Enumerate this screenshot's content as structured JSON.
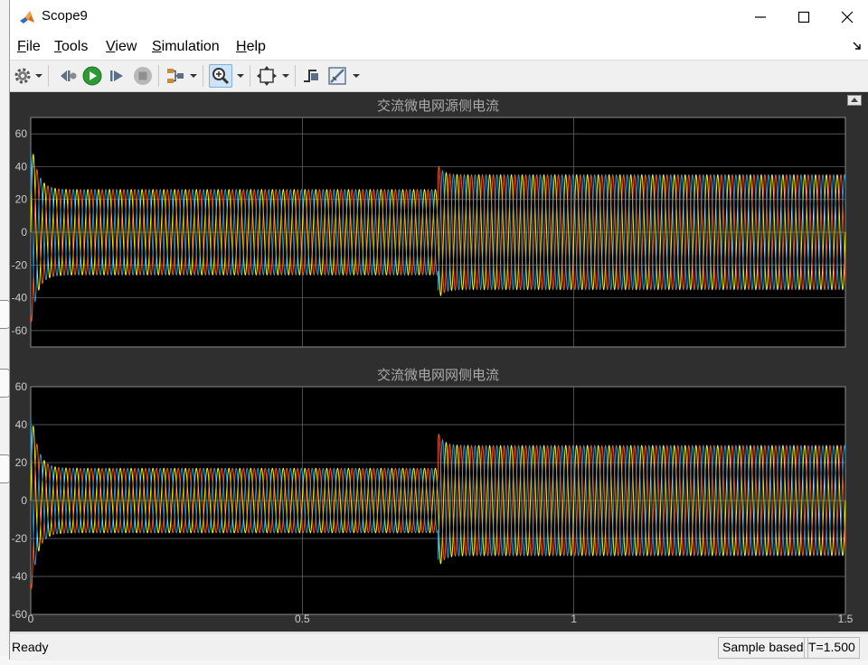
{
  "window": {
    "title": "Scope9"
  },
  "menu": [
    {
      "label": "File",
      "u": "F",
      "rest": "ile"
    },
    {
      "label": "Tools",
      "u": "T",
      "rest": "ools"
    },
    {
      "label": "View",
      "u": "V",
      "rest": "iew"
    },
    {
      "label": "Simulation",
      "u": "S",
      "rest": "imulation"
    },
    {
      "label": "Help",
      "u": "H",
      "rest": "elp"
    }
  ],
  "toolbar": [
    {
      "name": "settings",
      "icon": "gear-icon"
    },
    {
      "name": "step-back",
      "icon": "step-back-icon"
    },
    {
      "name": "run",
      "icon": "play-icon"
    },
    {
      "name": "step-forward",
      "icon": "step-forward-icon"
    },
    {
      "name": "stop",
      "icon": "stop-icon"
    },
    {
      "name": "highlight-simulink-block",
      "icon": "block-highlight-icon"
    },
    {
      "name": "zoom",
      "icon": "zoom-in-icon",
      "active": true
    },
    {
      "name": "autoscale",
      "icon": "autoscale-icon"
    },
    {
      "name": "trigger",
      "icon": "trigger-icon"
    },
    {
      "name": "measurements",
      "icon": "measurement-icon"
    }
  ],
  "status": {
    "ready": "Ready",
    "mode": "Sample based",
    "time": "T=1.500"
  },
  "colors": {
    "plot_bg": "#000000",
    "figure_bg": "#2f2f2f",
    "grid": "#6e6e6e",
    "axis_text": "#cccccc",
    "title_text": "#aaaaaa",
    "series": [
      "#ffff00",
      "#ff5a1e",
      "#2aa0e0"
    ]
  },
  "chart_data": [
    {
      "type": "line",
      "title": "交流微电网源侧电流",
      "xlim": [
        0,
        1.5
      ],
      "ylim": [
        -70,
        70
      ],
      "yticks": [
        60,
        40,
        20,
        0,
        -20,
        -40,
        -60
      ],
      "xticks": [],
      "grid": true,
      "series": [
        {
          "color": "#ffff00",
          "phase_deg": 0
        },
        {
          "color": "#ff5a1e",
          "phase_deg": -120
        },
        {
          "color": "#2aa0e0",
          "phase_deg": 120
        }
      ],
      "signal": {
        "frequency_hz": 50,
        "amplitude_before": 26,
        "amplitude_after": 35,
        "step_time": 0.75,
        "startup_peak": 58,
        "step_peak": 41
      }
    },
    {
      "type": "line",
      "title": "交流微电网网侧电流",
      "xlim": [
        0,
        1.5
      ],
      "ylim": [
        -60,
        60
      ],
      "yticks": [
        60,
        40,
        20,
        0,
        -20,
        -40,
        -60
      ],
      "xticks": [
        0,
        0.5,
        1,
        1.5
      ],
      "xticklabels": [
        "0",
        "0.5",
        "1",
        "1.5"
      ],
      "grid": true,
      "series": [
        {
          "color": "#ffff00",
          "phase_deg": 0
        },
        {
          "color": "#ff5a1e",
          "phase_deg": -120
        },
        {
          "color": "#2aa0e0",
          "phase_deg": 120
        }
      ],
      "signal": {
        "frequency_hz": 50,
        "amplitude_before": 17,
        "amplitude_after": 29,
        "step_time": 0.75,
        "startup_peak": 50,
        "step_peak": 36
      }
    }
  ]
}
